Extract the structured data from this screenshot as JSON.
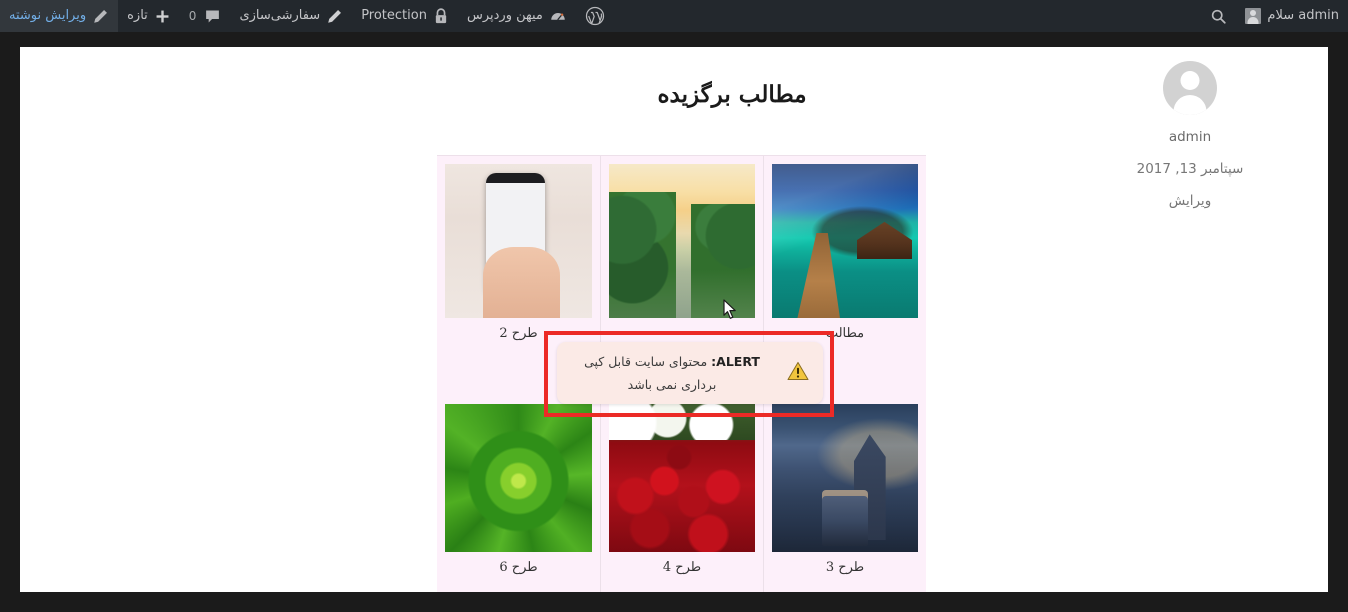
{
  "adminbar": {
    "left_items": [
      {
        "name": "search",
        "icon": "search-icon",
        "label": ""
      },
      {
        "name": "howdy",
        "icon": "avatar-icon",
        "label": "سلام admin"
      }
    ],
    "right_items": [
      {
        "name": "wp-logo",
        "icon": "wordpress-icon",
        "label": ""
      },
      {
        "name": "site-name",
        "icon": "dashboard-icon",
        "label": "میهن وردپرس"
      },
      {
        "name": "protection",
        "icon": "lock-icon",
        "label": "Protection"
      },
      {
        "name": "customize",
        "icon": "pencil-icon",
        "label": "سفارشی‌سازی"
      },
      {
        "name": "comments",
        "icon": "comment-icon",
        "label": "0"
      },
      {
        "name": "new-content",
        "icon": "plus-icon",
        "label": "تازه"
      },
      {
        "name": "edit-post",
        "icon": "pencil-icon",
        "label": "ویرایش نوشته"
      }
    ]
  },
  "post": {
    "title": "مطالب برگزیده"
  },
  "meta": {
    "avatar": "avatar-icon",
    "author": "admin",
    "date": "سپتامبر 13, 2017",
    "edit_label": "ویرایش"
  },
  "gallery": {
    "items": [
      {
        "caption": "مطالب",
        "art": "img-pier",
        "alt": "overwater-pier-tropical"
      },
      {
        "caption": "",
        "art": "img-river",
        "alt": "river-sunset-jungle"
      },
      {
        "caption": "طرح 2",
        "art": "img-phone",
        "alt": "hand-phone-stylus-drawing"
      },
      {
        "caption": "طرح 3",
        "art": "img-tram",
        "alt": "night-tram-street-painting"
      },
      {
        "caption": "طرح 4",
        "art": "img-roses",
        "alt": "red-roses-bouquet"
      },
      {
        "caption": "طرح 6",
        "art": "img-fern",
        "alt": "green-fern-rosette"
      }
    ]
  },
  "alert": {
    "prefix": "ALERT:",
    "message": "محتوای سایت قابل کپی برداری نمی باشد",
    "icon": "warning-triangle-icon",
    "border_color": "#ec2a26",
    "background_color": "#fbeae6"
  },
  "colors": {
    "adminbar_bg": "#23282d",
    "page_bg": "#1b1b1b",
    "content_bg": "#ffffff",
    "cell_bg": "#fdf0fa",
    "alert_red": "#ec2a26"
  }
}
